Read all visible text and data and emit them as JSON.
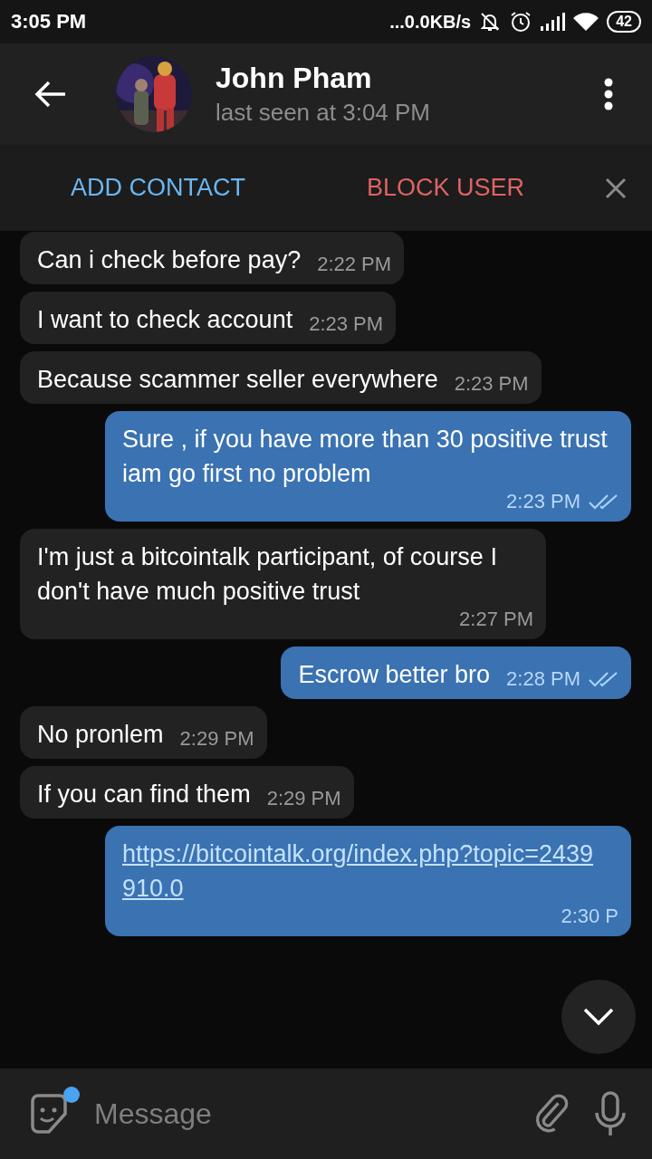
{
  "status_bar": {
    "time": "3:05 PM",
    "speed": "...0.0KB/s",
    "battery": "42"
  },
  "header": {
    "name": "John Pham",
    "last_seen": "last seen at 3:04 PM"
  },
  "action_bar": {
    "add": "ADD CONTACT",
    "block": "BLOCK USER"
  },
  "messages": [
    {
      "kind": "text",
      "out": false,
      "text": "Can i check before pay?",
      "time": "2:22 PM"
    },
    {
      "kind": "text",
      "out": false,
      "text": "I want to check account",
      "time": "2:23 PM"
    },
    {
      "kind": "text",
      "out": false,
      "text": "Because scammer seller everywhere",
      "time": "2:23 PM"
    },
    {
      "kind": "text",
      "out": true,
      "read": true,
      "text": "Sure , if you have more than 30 positive trust iam go first no problem",
      "time": "2:23 PM"
    },
    {
      "kind": "text",
      "out": false,
      "text": "I'm just a bitcointalk participant, of course I don't have much positive trust",
      "time": "2:27 PM"
    },
    {
      "kind": "text",
      "out": true,
      "read": true,
      "text": "Escrow better bro",
      "time": "2:28 PM"
    },
    {
      "kind": "text",
      "out": false,
      "text": "No pronlem",
      "time": "2:29 PM"
    },
    {
      "kind": "text",
      "out": false,
      "text": "If you can find them",
      "time": "2:29 PM"
    },
    {
      "kind": "link",
      "out": true,
      "text": "https://bitcointalk.org/index.php?topic=2439910.0",
      "time": "2:30 P"
    }
  ],
  "composer": {
    "placeholder": "Message",
    "sticker_badge": true
  }
}
